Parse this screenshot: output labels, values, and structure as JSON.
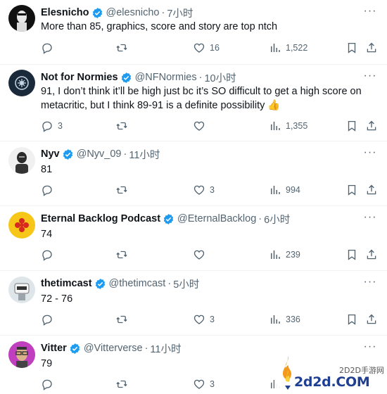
{
  "tweets": [
    {
      "name": "Elesnicho",
      "handle": "@elesnicho",
      "dot": "·",
      "time": "7小时",
      "text": "More than 85, graphics, score and story are top ntch",
      "replies": "",
      "retweets": "",
      "likes": "16",
      "views": "1,522"
    },
    {
      "name": "Not for Normies",
      "handle": "@NFNormies",
      "dot": "·",
      "time": "10小时",
      "text": "91, I don’t think it’ll be high just bc it’s SO difficult to get a high score on metacritic, but I think 89-91 is a definite possibility 👍",
      "replies": "3",
      "retweets": "",
      "likes": "",
      "views": "1,355"
    },
    {
      "name": "Nyv",
      "handle": "@Nyv_09",
      "dot": "·",
      "time": "11小时",
      "text": "81",
      "replies": "",
      "retweets": "",
      "likes": "3",
      "views": "994"
    },
    {
      "name": "Eternal Backlog Podcast",
      "handle": "@EternalBacklog",
      "dot": "·",
      "time": "6小时",
      "text": "74",
      "replies": "",
      "retweets": "",
      "likes": "",
      "views": "239"
    },
    {
      "name": "thetimcast",
      "handle": "@thetimcast",
      "dot": "·",
      "time": "5小时",
      "text": "72 - 76",
      "replies": "",
      "retweets": "",
      "likes": "3",
      "views": "336"
    },
    {
      "name": "Vitter",
      "handle": "@Vitterverse",
      "dot": "·",
      "time": "11小时",
      "text": "79",
      "replies": "",
      "retweets": "",
      "likes": "3",
      "views": ""
    }
  ],
  "more_glyph": "···",
  "watermark": {
    "small": "2D2D手游网",
    "big": "2d2d.COM"
  },
  "colors": {
    "text": "#0f1419",
    "muted": "#536471",
    "verified": "#1d9bf0",
    "watermark_blue": "#1f3f93"
  }
}
